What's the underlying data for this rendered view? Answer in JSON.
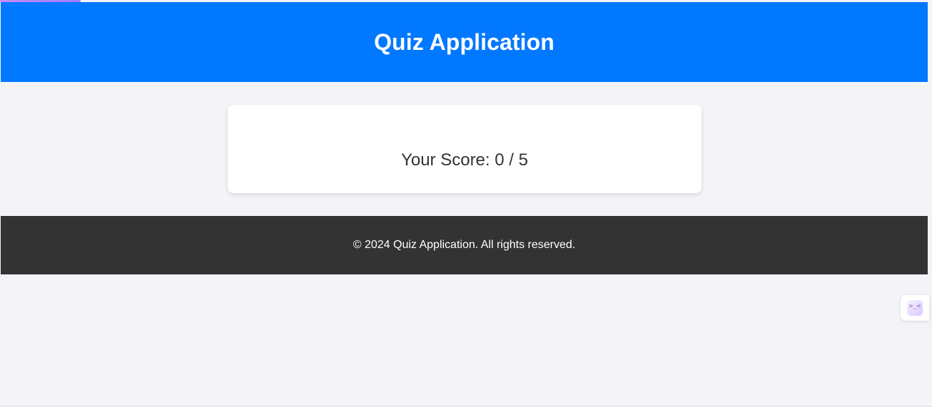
{
  "header": {
    "title": "Quiz Application"
  },
  "result": {
    "score_text": "Your Score: 0 / 5"
  },
  "footer": {
    "copyright": "© 2024 Quiz Application. All rights reserved."
  },
  "widget": {
    "icon_text": ">_<",
    "icon_name": "assistant-icon"
  },
  "colors": {
    "header": "#0078ff",
    "footer": "#333333",
    "background": "#f4f4f8",
    "card": "#ffffff"
  }
}
